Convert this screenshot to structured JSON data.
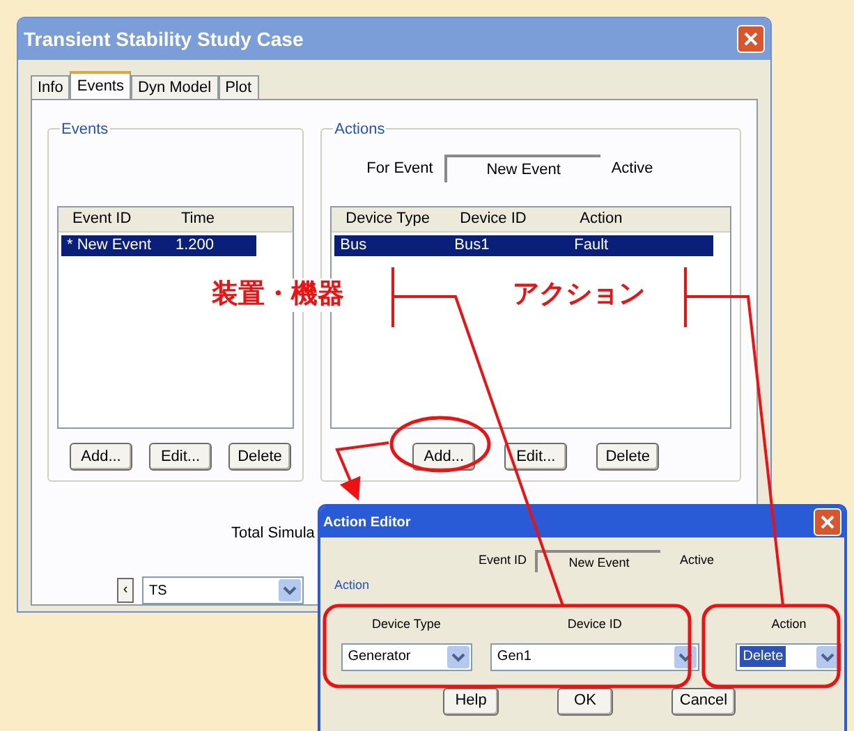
{
  "main_window": {
    "title": "Transient Stability Study Case",
    "tabs": [
      {
        "label": "Info",
        "selected": false
      },
      {
        "label": "Events",
        "selected": true
      },
      {
        "label": "Dyn Model",
        "selected": false
      },
      {
        "label": "Plot",
        "selected": false
      }
    ],
    "events_group": {
      "title": "Events",
      "columns": [
        "Event ID",
        "Time"
      ],
      "rows": [
        {
          "cells": [
            "* New Event",
            "1.200"
          ],
          "selected": true
        }
      ],
      "buttons": [
        "Add...",
        "Edit...",
        "Delete"
      ]
    },
    "actions_group": {
      "title": "Actions",
      "for_event_label": "For Event",
      "for_event_value": "New Event",
      "status": "Active",
      "columns": [
        "Device Type",
        "Device ID",
        "Action"
      ],
      "rows": [
        {
          "cells": [
            "Bus",
            "Bus1",
            "Fault"
          ],
          "selected": true
        }
      ],
      "buttons": [
        "Add...",
        "Edit...",
        "Delete"
      ]
    },
    "total_label": "Total Simula",
    "nav_button": "‹",
    "study_case": "TS"
  },
  "action_editor": {
    "title": "Action Editor",
    "event_id_label": "Event ID",
    "event_id_value": "New Event",
    "status": "Active",
    "group_title": "Action",
    "device_type_label": "Device Type",
    "device_type_value": "Generator",
    "device_id_label": "Device ID",
    "device_id_value": "Gen1",
    "action_label": "Action",
    "action_value": "Delete",
    "buttons": [
      "Help",
      "OK",
      "Cancel"
    ]
  },
  "annotations": {
    "device_label": "装置・機器",
    "action_label": "アクション"
  }
}
